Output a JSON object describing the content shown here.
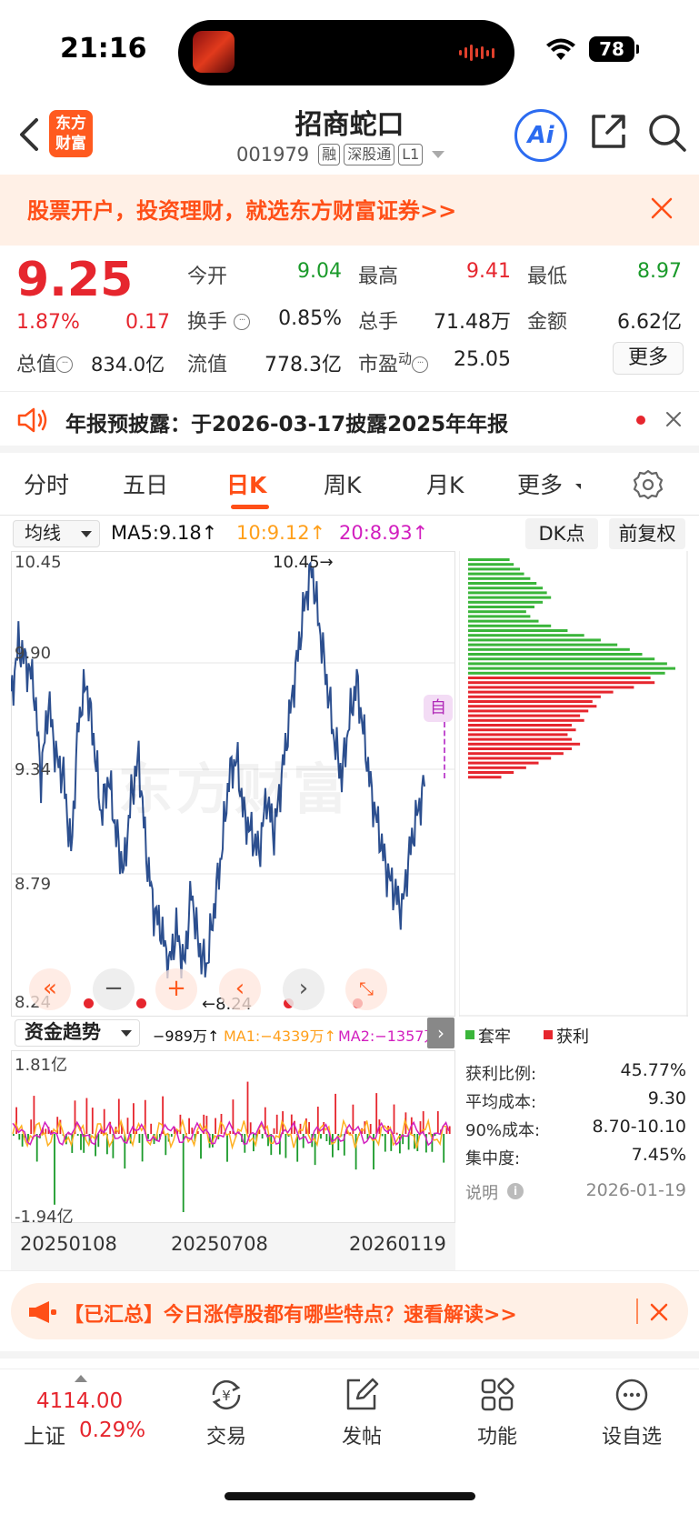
{
  "status_bar": {
    "time": "21:16",
    "battery": "78"
  },
  "header": {
    "logo_line1": "东方",
    "logo_line2": "财富",
    "stock_name": "招商蛇口",
    "stock_code": "001979",
    "tags": [
      "融",
      "深股通",
      "L1"
    ],
    "ai_label": "Ai"
  },
  "promo": {
    "text": "股票开户，投资理财，就选东方财富证券>>"
  },
  "quote": {
    "price": "9.25",
    "change_pct": "1.87%",
    "change_amt": "0.17",
    "open_label": "今开",
    "open": "9.04",
    "high_label": "最高",
    "high": "9.41",
    "low_label": "最低",
    "low": "8.97",
    "turnover_label": "换手",
    "turnover": "0.85%",
    "volume_label": "总手",
    "volume": "71.48万",
    "amount_label": "金额",
    "amount": "6.62亿",
    "total_value_label": "总值",
    "total_value": "834.0亿",
    "float_value_label": "流值",
    "float_value": "778.3亿",
    "pe_label": "市盈",
    "pe_sup": "动",
    "pe": "25.05",
    "more_label": "更多"
  },
  "notice": {
    "text": "年报预披露：于2026-03-17披露2025年年报"
  },
  "tabs": [
    "分时",
    "五日",
    "日K",
    "周K",
    "月K",
    "更多"
  ],
  "ma_row": {
    "select_label": "均线",
    "ma5": "MA5:9.18↑",
    "ma10": "10:9.12↑",
    "ma20": "20:8.93↑",
    "dk_label": "DK点",
    "fq_label": "前复权"
  },
  "kline": {
    "y_labels": [
      "10.45",
      "9.90",
      "9.34",
      "8.79",
      "8.24"
    ],
    "high_marker": "10.45→",
    "low_marker": "←8.24",
    "watermark": "东方财富",
    "zi_badge": "自"
  },
  "chart_data": [
    {
      "type": "line",
      "title": "日K",
      "ylim": [
        8.24,
        10.45
      ],
      "series": [
        {
          "name": "收盘",
          "values": [
            9.7,
            10.0,
            9.9,
            9.8,
            9.3,
            9.7,
            9.4,
            9.3,
            8.9,
            9.6,
            9.8,
            9.5,
            9.1,
            9.3,
            9.0,
            8.8,
            9.2,
            9.4,
            8.9,
            8.6,
            8.5,
            8.3,
            8.5,
            8.3,
            8.7,
            8.4,
            8.3,
            8.6,
            8.9,
            9.3,
            9.4,
            9.1,
            9.0,
            8.9,
            9.2,
            9.0,
            9.3,
            9.6,
            9.9,
            10.2,
            10.4,
            10.1,
            9.8,
            9.5,
            9.3,
            9.6,
            9.8,
            9.5,
            9.2,
            9.0,
            8.8,
            8.7,
            8.6,
            8.9,
            9.1,
            9.25
          ]
        }
      ]
    },
    {
      "type": "bar",
      "title": "筹码分布",
      "series": [
        {
          "name": "套牢",
          "values": [
            0.2,
            0.22,
            0.25,
            0.27,
            0.3,
            0.33,
            0.36,
            0.38,
            0.4,
            0.36,
            0.32,
            0.28,
            0.3,
            0.34,
            0.4,
            0.48,
            0.56,
            0.64,
            0.72,
            0.78,
            0.84,
            0.9,
            0.96,
            1.0,
            0.95
          ]
        },
        {
          "name": "获利",
          "values": [
            0.88,
            0.9,
            0.8,
            0.7,
            0.64,
            0.6,
            0.62,
            0.58,
            0.54,
            0.56,
            0.5,
            0.52,
            0.48,
            0.5,
            0.54,
            0.5,
            0.46,
            0.4,
            0.34,
            0.28,
            0.22,
            0.16
          ]
        }
      ]
    },
    {
      "type": "bar",
      "title": "资金趋势",
      "ylim": [
        -1.94,
        1.81
      ],
      "x_ticks": [
        "20250108",
        "20250708",
        "20260119"
      ]
    }
  ],
  "flow": {
    "select_label": "资金趋势",
    "value": "−989万↑",
    "ma1": "MA1:−4339万↑",
    "ma2": "MA2:−1357万↑",
    "y_top": "1.81亿",
    "y_bottom": "-1.94亿",
    "dates": [
      "20250108",
      "20250708",
      "20260119"
    ]
  },
  "chip": {
    "legend_trapped": "套牢",
    "legend_profit": "获利",
    "stats": [
      {
        "label": "获利比例:",
        "value": "45.77%"
      },
      {
        "label": "平均成本:",
        "value": "9.30"
      },
      {
        "label": "90%成本:",
        "value": "8.70-10.10"
      },
      {
        "label": "集中度:",
        "value": "7.45%"
      }
    ],
    "explain": "说明",
    "date": "2026-01-19"
  },
  "news": {
    "text": "【已汇总】今日涨停股都有哪些特点？速看解读>>"
  },
  "bottom": {
    "index_value": "4114.00",
    "index_name": "上证",
    "index_pct": "0.29%",
    "nav": [
      "交易",
      "发帖",
      "功能",
      "设自选"
    ]
  },
  "colors": {
    "up": "#e6262e",
    "down": "#1a9a2a",
    "brand": "#ff4f17",
    "ma10": "#ff9f1a",
    "ma20": "#d21fbf"
  }
}
